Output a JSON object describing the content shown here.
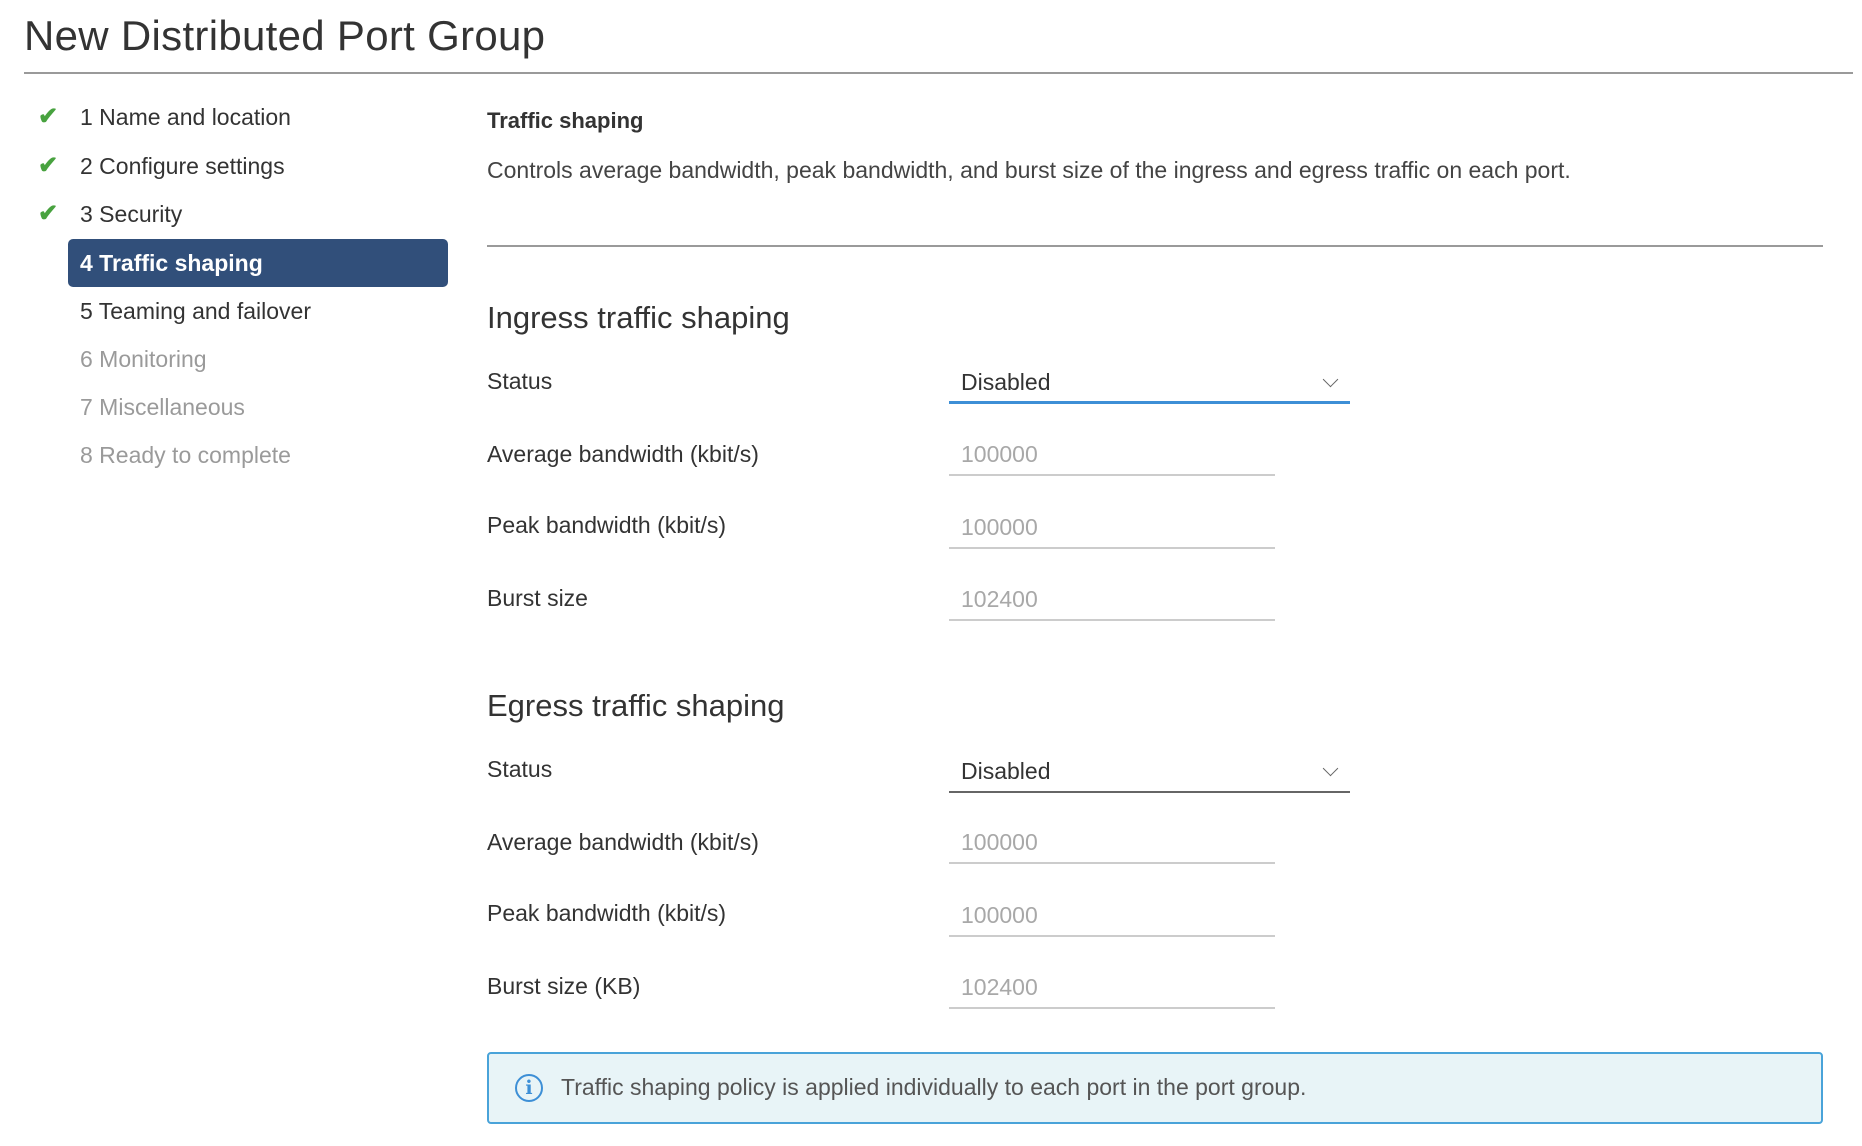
{
  "title": "New Distributed Port Group",
  "nav": [
    {
      "label": "1 Name and location",
      "state": "done"
    },
    {
      "label": "2 Configure settings",
      "state": "done"
    },
    {
      "label": "3 Security",
      "state": "done"
    },
    {
      "label": "4 Traffic shaping",
      "state": "active"
    },
    {
      "label": "5 Teaming and failover",
      "state": "todo"
    },
    {
      "label": "6 Monitoring",
      "state": "disabled"
    },
    {
      "label": "7 Miscellaneous",
      "state": "disabled"
    },
    {
      "label": "8 Ready to complete",
      "state": "disabled"
    }
  ],
  "check_glyph": "✔",
  "section": {
    "title": "Traffic shaping",
    "description": "Controls average bandwidth, peak bandwidth, and burst size of the ingress and egress traffic on each port."
  },
  "ingress": {
    "heading": "Ingress traffic shaping",
    "status_label": "Status",
    "status_value": "Disabled",
    "avg_label": "Average bandwidth (kbit/s)",
    "avg_value": "100000",
    "peak_label": "Peak bandwidth (kbit/s)",
    "peak_value": "100000",
    "burst_label": "Burst size",
    "burst_value": "102400"
  },
  "egress": {
    "heading": "Egress traffic shaping",
    "status_label": "Status",
    "status_value": "Disabled",
    "avg_label": "Average bandwidth (kbit/s)",
    "avg_value": "100000",
    "peak_label": "Peak bandwidth (kbit/s)",
    "peak_value": "100000",
    "burst_label": "Burst size (KB)",
    "burst_value": "102400"
  },
  "info": {
    "icon_glyph": "i",
    "text": "Traffic shaping policy is applied individually to each port in the port group."
  },
  "colors": {
    "accent": "#314f7a",
    "focus": "#3d8fd6",
    "check": "#48a23f",
    "info_bg": "#e8f4f7"
  }
}
